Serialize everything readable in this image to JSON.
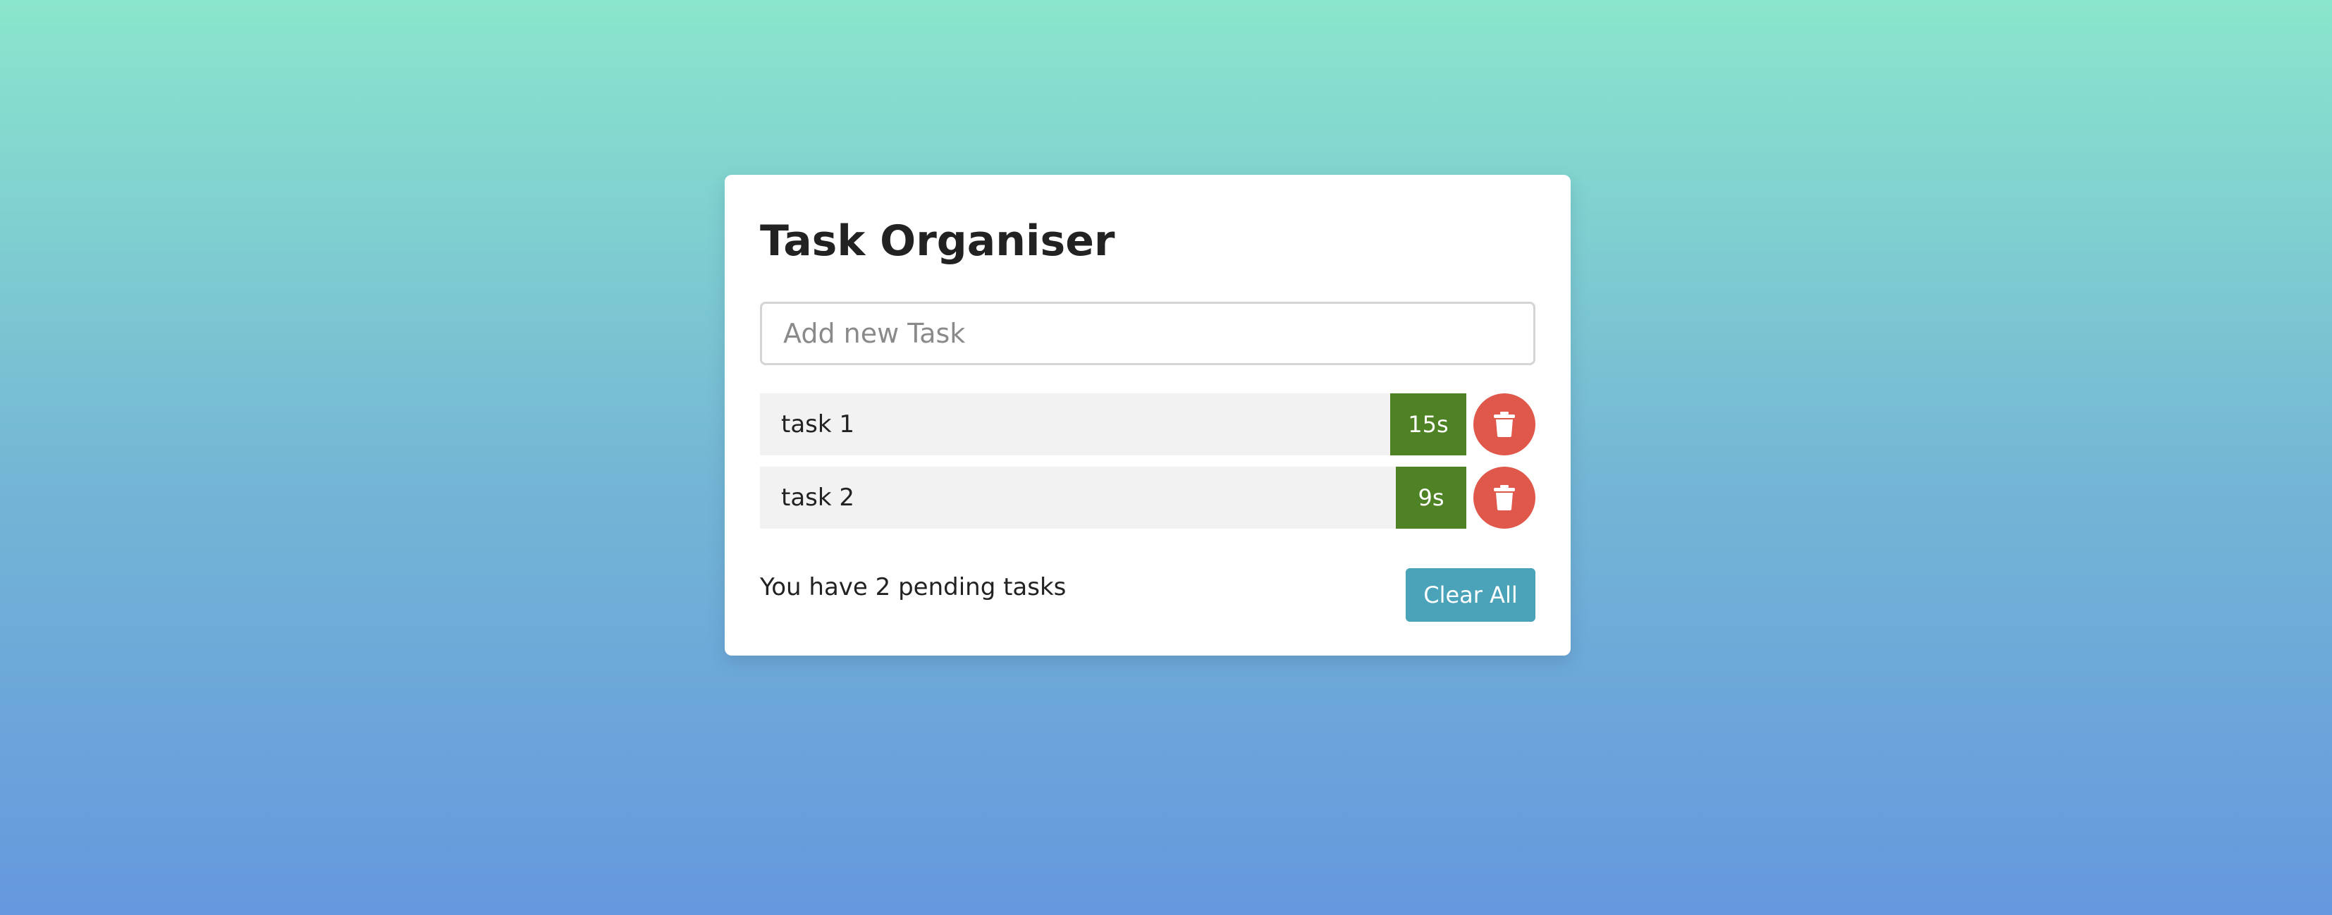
{
  "app": {
    "title": "Task Organiser"
  },
  "input": {
    "placeholder": "Add new Task",
    "value": ""
  },
  "tasks": [
    {
      "label": "task 1",
      "timer": "15s"
    },
    {
      "label": "task 2",
      "timer": "9s"
    }
  ],
  "footer": {
    "pending_text": "You have 2 pending tasks",
    "clear_label": "Clear All"
  },
  "icons": {
    "delete": "trash-icon"
  },
  "colors": {
    "background_top": "#8ae6cc",
    "background_bottom": "#6598de",
    "timer": "#4e8224",
    "delete": "#e0584b",
    "clear_button": "#4aa3b8"
  }
}
